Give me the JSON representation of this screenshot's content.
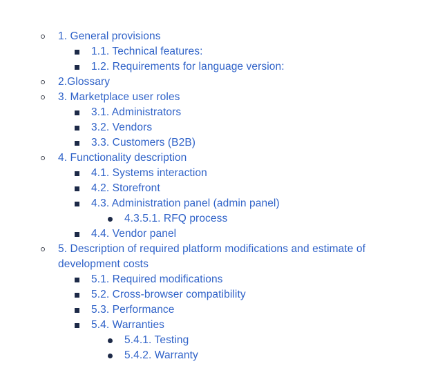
{
  "toc": [
    {
      "level": 1,
      "bullet": "circle",
      "label": "1. General provisions"
    },
    {
      "level": 2,
      "bullet": "square",
      "label": "1.1. Technical features:"
    },
    {
      "level": 2,
      "bullet": "square",
      "label": "1.2. Requirements for language version:"
    },
    {
      "level": 1,
      "bullet": "circle",
      "label": "2.Glossary"
    },
    {
      "level": 1,
      "bullet": "circle",
      "label": "3. Marketplace user roles"
    },
    {
      "level": 2,
      "bullet": "square",
      "label": "3.1. Administrators"
    },
    {
      "level": 2,
      "bullet": "square",
      "label": "3.2. Vendors"
    },
    {
      "level": 2,
      "bullet": "square",
      "label": "3.3. Customers (B2B)"
    },
    {
      "level": 1,
      "bullet": "circle",
      "label": "4. Functionality description"
    },
    {
      "level": 2,
      "bullet": "square",
      "label": "4.1. Systems interaction"
    },
    {
      "level": 2,
      "bullet": "square",
      "label": "4.2. Storefront"
    },
    {
      "level": 2,
      "bullet": "square",
      "label": "4.3. Administration panel (admin panel)"
    },
    {
      "level": 3,
      "bullet": "disc",
      "label": "4.3.5.1. RFQ process"
    },
    {
      "level": 2,
      "bullet": "square",
      "label": "4.4. Vendor panel"
    },
    {
      "level": 1,
      "bullet": "circle",
      "label": "5. Description of required platform modifications and estimate of development costs"
    },
    {
      "level": 2,
      "bullet": "square",
      "label": "5.1. Required modifications"
    },
    {
      "level": 2,
      "bullet": "square",
      "label": "5.2. Cross-browser compatibility"
    },
    {
      "level": 2,
      "bullet": "square",
      "label": "5.3. Performance"
    },
    {
      "level": 2,
      "bullet": "square",
      "label": "5.4. Warranties"
    },
    {
      "level": 3,
      "bullet": "disc",
      "label": "5.4.1. Testing"
    },
    {
      "level": 3,
      "bullet": "disc",
      "label": "5.4.2. Warranty"
    }
  ],
  "colors": {
    "link": "#2f62c8",
    "bullet": "#1d2a48"
  }
}
